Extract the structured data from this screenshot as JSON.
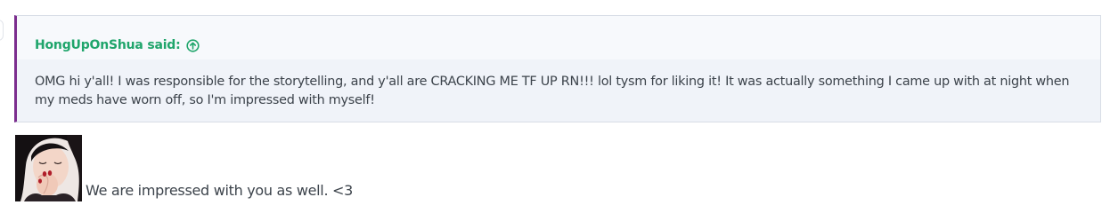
{
  "quote": {
    "author_line": "HongUpOnShua said:",
    "jump_icon": "arrow-up-circle-icon",
    "text": "OMG hi y'all! I was responsible for the storytelling, and y'all are CRACKING ME TF UP RN!!! lol tysm for liking it! It was actually something I came up with at night when my meds have worn off, so I'm impressed with myself!",
    "accent_color": "#7b2d8e",
    "author_color": "#1fa56b"
  },
  "reply": {
    "image": "person-photo",
    "text": "We are impressed with you as well. <3"
  }
}
